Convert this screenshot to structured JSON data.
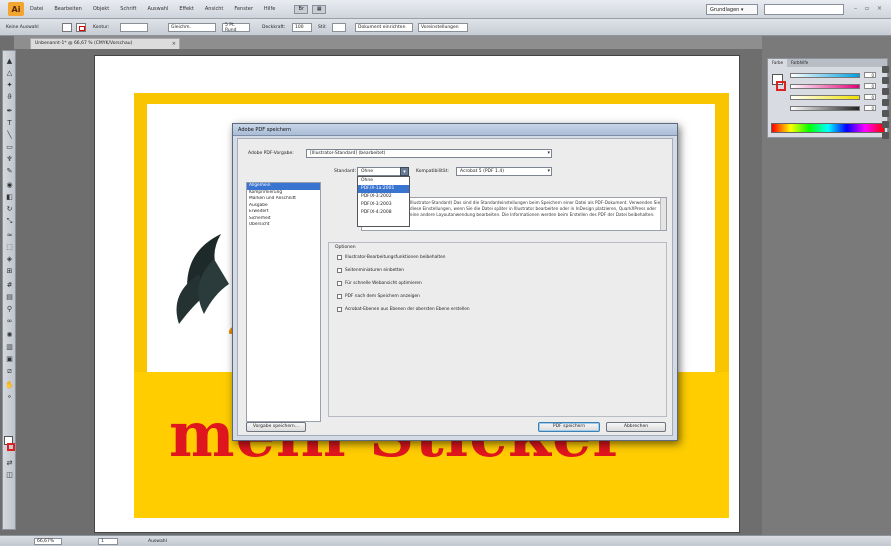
{
  "app": {
    "logo_label": "Ai",
    "menus": [
      "Datei",
      "Bearbeiten",
      "Objekt",
      "Schrift",
      "Auswahl",
      "Effekt",
      "Ansicht",
      "Fenster",
      "Hilfe"
    ],
    "bridge_label": "Br",
    "arrange_label": "▦",
    "workspace": "Grundlagen ▾",
    "window_controls": "– ▫ ×"
  },
  "control_bar": {
    "selection_label": "Keine Auswahl",
    "stroke_label": "Kontur:",
    "stroke_profile": "Gleichm.",
    "brush_label": "5 Pt. Rund",
    "opacity_label": "Deckkraft:",
    "opacity_value": "100",
    "style_label": "Stil:",
    "doc_setup": "Dokument einrichten",
    "prefs": "Voreinstellungen"
  },
  "document_tab": {
    "title": "Unbenannt-1* @ 66,67 % (CMYK/Vorschau)",
    "close": "×"
  },
  "artwork": {
    "sticker_text": "mein Sticker",
    "colors": {
      "frame": "#f9c500",
      "text": "#e0161e"
    }
  },
  "color_panel": {
    "tabs": [
      "Farbe",
      "Farbhilfe"
    ],
    "sliders": [
      {
        "label": "C",
        "color": "#00a0e0",
        "value": "0"
      },
      {
        "label": "M",
        "color": "#e0007a",
        "value": "0"
      },
      {
        "label": "Y",
        "color": "#f0e000",
        "value": "0"
      },
      {
        "label": "K",
        "color": "#222222",
        "value": "0"
      }
    ]
  },
  "status_bar": {
    "zoom": "66,67%",
    "page": "1",
    "tool": "Auswahl"
  },
  "pdf_dialog": {
    "title": "Adobe PDF speichern",
    "preset_label": "Adobe PDF-Vorgabe:",
    "preset_value": "[Illustrator-Standard] (bearbeitet)",
    "standard_label": "Standard:",
    "standard_value": "Ohne",
    "compat_label": "Kompatibilität:",
    "compat_value": "Acrobat 5 (PDF 1.4)",
    "standard_options": [
      "Ohne",
      "PDF/X-1a:2001",
      "PDF/X-3:2002",
      "PDF/X-3:2003",
      "PDF/X-4:2008"
    ],
    "categories": [
      "Allgemein",
      "Komprimierung",
      "Marken und Anschnitt",
      "Ausgabe",
      "Erweitert",
      "Sicherheit",
      "Übersicht"
    ],
    "description": "Illustrator-Standard) Das sind die Standardeinstellungen beim Speichern einer Datei als PDF-Dokument. Verwenden Sie diese Einstellungen, wenn Sie die Datei später in Illustrator bearbeiten oder in InDesign platzieren, QuarkXPress oder eine andere Layoutanwendung bearbeiten. Die Informationen werden beim Erstellen des PDF der Datei beibehalten.",
    "options_title": "Optionen",
    "options": [
      "Illustrator-Bearbeitungsfunktionen beibehalten",
      "Seitenminiaturen einbetten",
      "Für schnelle Webansicht optimieren",
      "PDF nach dem Speichern anzeigen",
      "Acrobat-Ebenen aus Ebenen der obersten Ebene erstellen"
    ],
    "btn_save_preset": "Vorgabe speichern...",
    "btn_save_pdf": "PDF speichern",
    "btn_cancel": "Abbrechen"
  }
}
